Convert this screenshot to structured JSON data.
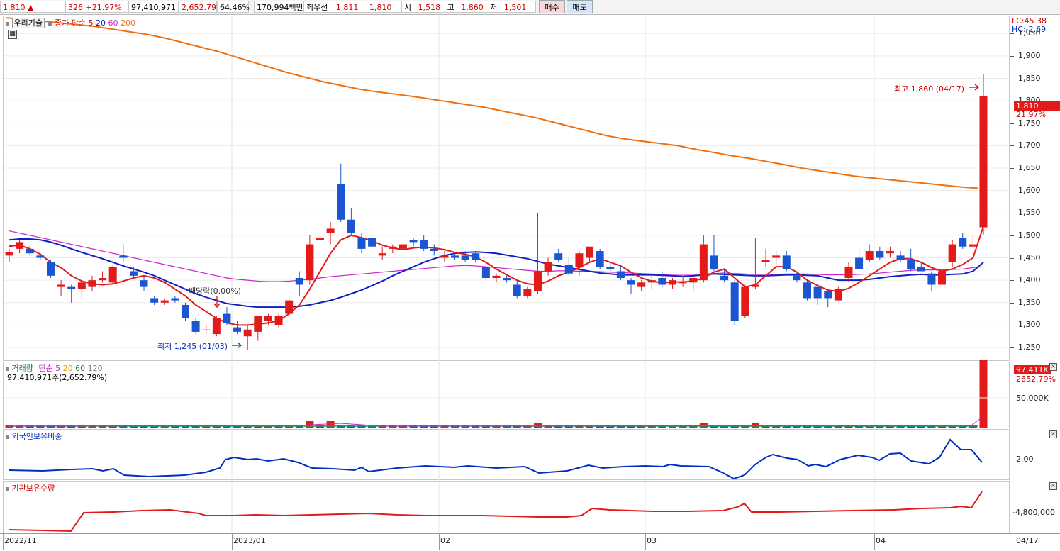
{
  "topbar": {
    "price": "1,810",
    "change": "326",
    "change_pct": "+21.97%",
    "volume": "97,410,971",
    "volume_pct": "2,652.79%",
    "turnover": "64.46%",
    "amount": "170,994백만",
    "best_label": "최우선",
    "best_ask": "1,811",
    "best_bid": "1,810",
    "open_label": "시",
    "open": "1,518",
    "high_label": "고",
    "high": "1,860",
    "low_label": "저",
    "low": "1,501",
    "buy_label": "매수",
    "sell_label": "매도"
  },
  "price_pane": {
    "stock_name": "우리기술",
    "ma_prefix": "종가 단순",
    "ma_periods": [
      "5",
      "20",
      "60",
      "200"
    ],
    "lc": "LC:45.38",
    "hc": "HC:-2.69",
    "y_ticks": [
      "1,950",
      "1,900",
      "1,850",
      "1,800",
      "1,750",
      "1,700",
      "1,650",
      "1,600",
      "1,550",
      "1,500",
      "1,450",
      "1,400",
      "1,350",
      "1,300",
      "1,250"
    ],
    "current_price_box": "1,810",
    "current_pct": "21.97%",
    "high_annotation": "최고 1,860 (04/17)",
    "low_annotation": "최저 1,245 (01/03)",
    "dividend_annotation": "배당락(0.00%)"
  },
  "volume_pane": {
    "label": "거래량",
    "ma_prefix": "단순",
    "ma_periods": [
      "5",
      "20",
      "60",
      "120"
    ],
    "current": "97,410,971주(2,652.79%)",
    "box": "97,411K",
    "box_pct": "2652.79%",
    "y_tick": "50,000K"
  },
  "foreign_pane": {
    "label": "외국인보유비중",
    "y_tick": "2.00"
  },
  "inst_pane": {
    "label": "기관보유수량",
    "y_tick": "-4,800,000"
  },
  "x_axis": {
    "labels": [
      "2022/11",
      "2023/01",
      "02",
      "03",
      "04",
      "04/17"
    ]
  },
  "colors": {
    "up": "#e31a1a",
    "down": "#1a56d1",
    "ma5": "#e31a1a",
    "ma20": "#1020c0",
    "ma60": "#d020d0",
    "ma200": "#f07010"
  },
  "chart_data": {
    "type": "candlestick",
    "ylim": [
      1225,
      1985
    ],
    "candles": [
      [
        1455,
        1470,
        1440,
        1462
      ],
      [
        1470,
        1490,
        1460,
        1485
      ],
      [
        1470,
        1480,
        1455,
        1460
      ],
      [
        1455,
        1460,
        1445,
        1450
      ],
      [
        1440,
        1445,
        1405,
        1410
      ],
      [
        1385,
        1400,
        1365,
        1390
      ],
      [
        1385,
        1390,
        1350,
        1380
      ],
      [
        1380,
        1400,
        1360,
        1395
      ],
      [
        1385,
        1410,
        1375,
        1400
      ],
      [
        1400,
        1420,
        1395,
        1405
      ],
      [
        1395,
        1435,
        1390,
        1430
      ],
      [
        1455,
        1480,
        1440,
        1450
      ],
      [
        1420,
        1430,
        1405,
        1410
      ],
      [
        1400,
        1410,
        1375,
        1385
      ],
      [
        1360,
        1365,
        1345,
        1350
      ],
      [
        1350,
        1360,
        1345,
        1355
      ],
      [
        1360,
        1365,
        1350,
        1355
      ],
      [
        1345,
        1350,
        1310,
        1315
      ],
      [
        1310,
        1315,
        1280,
        1285
      ],
      [
        1290,
        1300,
        1280,
        1290
      ],
      [
        1280,
        1320,
        1275,
        1315
      ],
      [
        1325,
        1340,
        1300,
        1305
      ],
      [
        1295,
        1310,
        1280,
        1285
      ],
      [
        1275,
        1300,
        1245,
        1290
      ],
      [
        1285,
        1320,
        1265,
        1320
      ],
      [
        1310,
        1325,
        1300,
        1320
      ],
      [
        1300,
        1325,
        1295,
        1320
      ],
      [
        1325,
        1360,
        1320,
        1355
      ],
      [
        1405,
        1420,
        1365,
        1390
      ],
      [
        1400,
        1500,
        1390,
        1480
      ],
      [
        1490,
        1500,
        1480,
        1495
      ],
      [
        1505,
        1530,
        1480,
        1515
      ],
      [
        1615,
        1660,
        1530,
        1535
      ],
      [
        1535,
        1560,
        1500,
        1505
      ],
      [
        1495,
        1505,
        1460,
        1470
      ],
      [
        1495,
        1500,
        1470,
        1475
      ],
      [
        1455,
        1475,
        1445,
        1460
      ],
      [
        1470,
        1480,
        1460,
        1475
      ],
      [
        1470,
        1485,
        1465,
        1480
      ],
      [
        1490,
        1495,
        1475,
        1485
      ],
      [
        1490,
        1500,
        1465,
        1470
      ],
      [
        1470,
        1480,
        1455,
        1465
      ],
      [
        1450,
        1465,
        1440,
        1455
      ],
      [
        1455,
        1460,
        1445,
        1450
      ],
      [
        1455,
        1465,
        1440,
        1445
      ],
      [
        1460,
        1465,
        1440,
        1445
      ],
      [
        1430,
        1440,
        1400,
        1405
      ],
      [
        1405,
        1415,
        1395,
        1410
      ],
      [
        1405,
        1410,
        1395,
        1400
      ],
      [
        1390,
        1400,
        1360,
        1365
      ],
      [
        1365,
        1385,
        1360,
        1380
      ],
      [
        1375,
        1550,
        1370,
        1420
      ],
      [
        1420,
        1450,
        1410,
        1440
      ],
      [
        1460,
        1470,
        1440,
        1445
      ],
      [
        1435,
        1450,
        1410,
        1415
      ],
      [
        1430,
        1465,
        1410,
        1460
      ],
      [
        1450,
        1470,
        1440,
        1475
      ],
      [
        1465,
        1470,
        1425,
        1430
      ],
      [
        1430,
        1440,
        1420,
        1425
      ],
      [
        1420,
        1435,
        1400,
        1405
      ],
      [
        1400,
        1405,
        1370,
        1390
      ],
      [
        1385,
        1400,
        1375,
        1395
      ],
      [
        1395,
        1410,
        1380,
        1400
      ],
      [
        1405,
        1420,
        1385,
        1390
      ],
      [
        1390,
        1405,
        1380,
        1400
      ],
      [
        1395,
        1410,
        1385,
        1395
      ],
      [
        1395,
        1410,
        1375,
        1405
      ],
      [
        1400,
        1500,
        1395,
        1480
      ],
      [
        1455,
        1500,
        1420,
        1425
      ],
      [
        1410,
        1425,
        1395,
        1400
      ],
      [
        1395,
        1400,
        1300,
        1310
      ],
      [
        1320,
        1390,
        1315,
        1385
      ],
      [
        1385,
        1495,
        1380,
        1390
      ],
      [
        1440,
        1470,
        1430,
        1445
      ],
      [
        1450,
        1465,
        1435,
        1455
      ],
      [
        1455,
        1465,
        1420,
        1425
      ],
      [
        1410,
        1420,
        1395,
        1400
      ],
      [
        1395,
        1400,
        1355,
        1360
      ],
      [
        1385,
        1390,
        1345,
        1360
      ],
      [
        1375,
        1380,
        1340,
        1360
      ],
      [
        1355,
        1385,
        1355,
        1380
      ],
      [
        1405,
        1440,
        1395,
        1430
      ],
      [
        1450,
        1470,
        1440,
        1425
      ],
      [
        1445,
        1480,
        1440,
        1465
      ],
      [
        1465,
        1475,
        1445,
        1450
      ],
      [
        1460,
        1475,
        1450,
        1465
      ],
      [
        1455,
        1465,
        1440,
        1445
      ],
      [
        1445,
        1470,
        1420,
        1425
      ],
      [
        1430,
        1440,
        1420,
        1420
      ],
      [
        1415,
        1420,
        1375,
        1390
      ],
      [
        1390,
        1425,
        1385,
        1420
      ],
      [
        1440,
        1490,
        1430,
        1480
      ],
      [
        1495,
        1505,
        1470,
        1475
      ],
      [
        1475,
        1500,
        1470,
        1480
      ],
      [
        1518,
        1860,
        1501,
        1810
      ]
    ],
    "ma5": [
      1476,
      1478,
      1470,
      1458,
      1440,
      1428,
      1410,
      1398,
      1392,
      1390,
      1392,
      1398,
      1405,
      1410,
      1405,
      1395,
      1380,
      1365,
      1345,
      1330,
      1315,
      1305,
      1300,
      1300,
      1302,
      1305,
      1310,
      1325,
      1345,
      1380,
      1420,
      1460,
      1490,
      1500,
      1495,
      1488,
      1478,
      1472,
      1468,
      1472,
      1474,
      1472,
      1468,
      1462,
      1458,
      1452,
      1440,
      1425,
      1412,
      1400,
      1392,
      1390,
      1398,
      1410,
      1418,
      1428,
      1440,
      1448,
      1440,
      1432,
      1418,
      1405,
      1398,
      1394,
      1396,
      1396,
      1398,
      1405,
      1418,
      1425,
      1405,
      1385,
      1390,
      1410,
      1430,
      1430,
      1418,
      1400,
      1388,
      1378,
      1375,
      1382,
      1395,
      1410,
      1425,
      1440,
      1448,
      1448,
      1440,
      1428,
      1420,
      1425,
      1435,
      1450,
      1520
    ],
    "ma20": [
      1490,
      1492,
      1492,
      1490,
      1485,
      1478,
      1470,
      1462,
      1455,
      1448,
      1440,
      1432,
      1425,
      1418,
      1410,
      1400,
      1390,
      1380,
      1370,
      1362,
      1355,
      1348,
      1345,
      1342,
      1340,
      1340,
      1340,
      1340,
      1342,
      1345,
      1350,
      1355,
      1362,
      1370,
      1378,
      1388,
      1398,
      1410,
      1420,
      1430,
      1440,
      1448,
      1455,
      1460,
      1462,
      1463,
      1462,
      1460,
      1456,
      1452,
      1448,
      1442,
      1436,
      1432,
      1428,
      1424,
      1420,
      1416,
      1414,
      1412,
      1412,
      1412,
      1412,
      1411,
      1410,
      1409,
      1410,
      1412,
      1414,
      1413,
      1412,
      1411,
      1410,
      1410,
      1411,
      1412,
      1412,
      1411,
      1410,
      1405,
      1400,
      1400,
      1400,
      1402,
      1405,
      1408,
      1410,
      1412,
      1413,
      1412,
      1412,
      1413,
      1414,
      1420,
      1440
    ],
    "ma60": [
      1510,
      1505,
      1500,
      1495,
      1490,
      1485,
      1480,
      1475,
      1470,
      1465,
      1460,
      1455,
      1450,
      1445,
      1440,
      1435,
      1430,
      1425,
      1420,
      1415,
      1410,
      1405,
      1402,
      1400,
      1398,
      1397,
      1397,
      1398,
      1400,
      1402,
      1405,
      1408,
      1410,
      1412,
      1414,
      1416,
      1418,
      1420,
      1422,
      1424,
      1426,
      1428,
      1430,
      1432,
      1433,
      1432,
      1430,
      1428,
      1426,
      1424,
      1422,
      1420,
      1420,
      1421,
      1421,
      1420,
      1420,
      1419,
      1418,
      1417,
      1416,
      1415,
      1414,
      1413,
      1413,
      1413,
      1413,
      1414,
      1415,
      1416,
      1415,
      1414,
      1413,
      1413,
      1413,
      1414,
      1414,
      1414,
      1413,
      1412,
      1412,
      1412,
      1413,
      1414,
      1416,
      1418,
      1420,
      1422,
      1423,
      1423,
      1423,
      1424,
      1425,
      1428,
      1430
    ],
    "ma200": [
      1985,
      1982,
      1978,
      1974,
      1970,
      1966,
      1960,
      1954,
      1948,
      1940,
      1930,
      1920,
      1910,
      1898,
      1886,
      1874,
      1862,
      1852,
      1842,
      1834,
      1826,
      1820,
      1815,
      1810,
      1804,
      1798,
      1792,
      1786,
      1778,
      1770,
      1762,
      1752,
      1742,
      1732,
      1722,
      1715,
      1710,
      1705,
      1700,
      1692,
      1685,
      1678,
      1672,
      1665,
      1658,
      1650,
      1644,
      1638,
      1632,
      1628,
      1624,
      1620,
      1616,
      1612,
      1608,
      1605
    ]
  }
}
